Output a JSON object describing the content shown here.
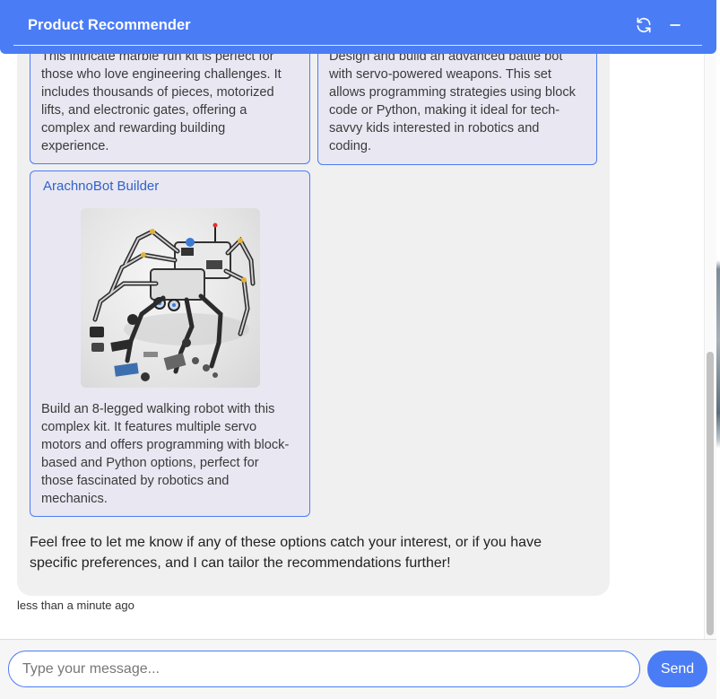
{
  "header": {
    "title": "Product Recommender",
    "refresh_icon": "refresh-icon",
    "minimize_icon": "minimize-icon"
  },
  "colors": {
    "accent": "#4a7cf5",
    "card_background": "#e9e7f2",
    "bubble_background": "#f0f0f0",
    "product_title": "#2f63c8"
  },
  "cards": [
    {
      "description_lines": [
        "This intricate marble run kit is perfect for",
        "those who love engineering challenges. It",
        "includes thousands of pieces, motorized",
        "lifts, and electronic gates, offering a",
        "complex and rewarding building",
        "experience."
      ]
    },
    {
      "description_lines": [
        "Design and build an advanced battle bot",
        "with servo-powered weapons. This set",
        "allows programming strategies using block",
        "code or Python, making it ideal for tech-",
        "savvy kids interested in robotics and",
        "coding."
      ]
    },
    {
      "title": "ArachnoBot Builder",
      "image_icon": "robot-spider-image",
      "description_lines": [
        "Build an 8-legged walking robot with this",
        "complex kit. It features multiple servo",
        "motors and offers programming with block-",
        "based and Python options, perfect for",
        "those fascinated by robotics and",
        "mechanics."
      ]
    }
  ],
  "message": {
    "closing_lines": [
      "Feel free to let me know if any of these options catch your interest, or if you have",
      "specific preferences, and I can tailor the recommendations further!"
    ],
    "timestamp": "less than a minute ago"
  },
  "input": {
    "placeholder": "Type your message...",
    "value": "",
    "send_label": "Send"
  }
}
